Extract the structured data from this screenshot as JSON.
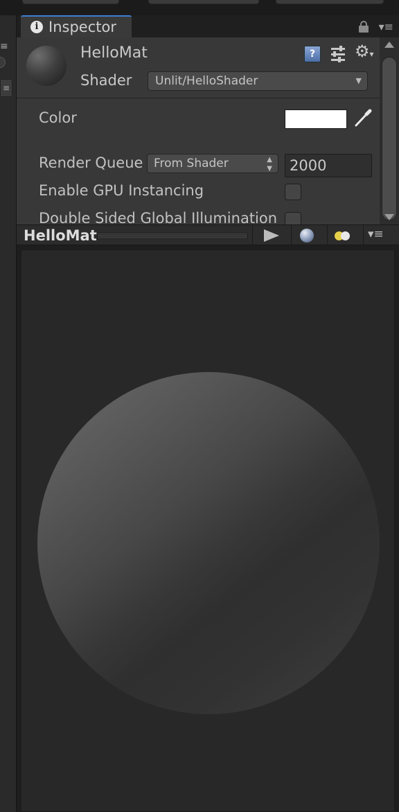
{
  "inspector_tab": {
    "label": "Inspector",
    "info_icon": "info-icon",
    "lock_icon": "lock-icon",
    "menu_icon": "tab-menu-icon"
  },
  "material": {
    "name": "HelloMat",
    "shader_label": "Shader",
    "shader_value": "Unlit/HelloShader",
    "header_icons": [
      "help-icon",
      "preset-sliders-icon",
      "gear-icon"
    ]
  },
  "properties": {
    "color_label": "Color",
    "color_value": "#ffffff",
    "render_queue_label": "Render Queue",
    "render_queue_mode": "From Shader",
    "render_queue_value": "2000",
    "gpu_instancing_label": "Enable GPU Instancing",
    "gpu_instancing_checked": false,
    "double_sided_gi_label": "Double Sided Global Illumination",
    "double_sided_gi_checked": false
  },
  "preview": {
    "title": "HelloMat",
    "buttons": [
      "play-icon",
      "sphere-mesh-icon",
      "lights-icon",
      "preview-menu-icon"
    ]
  },
  "colors": {
    "panel_bg": "#383838",
    "preview_bg": "#282828",
    "tab_accent": "#3d7fd6"
  }
}
